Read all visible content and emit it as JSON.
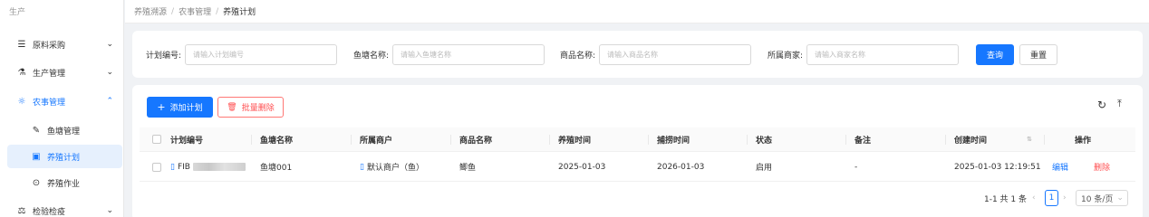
{
  "sidebar": {
    "top_label": "生产",
    "items": [
      {
        "label": "原料采购",
        "icon": "list-icon",
        "chevron": "⌄"
      },
      {
        "label": "生产管理",
        "icon": "flask-icon",
        "chevron": "⌄"
      },
      {
        "label": "农事管理",
        "icon": "sun-icon",
        "chevron": "⌃"
      },
      {
        "label": "鱼塘管理",
        "icon": "edit-icon"
      },
      {
        "label": "养殖计划",
        "icon": "calendar-icon"
      },
      {
        "label": "养殖作业",
        "icon": "play-icon"
      },
      {
        "label": "检验检疫",
        "icon": "scale-icon",
        "chevron": "⌄"
      }
    ]
  },
  "breadcrumb": [
    "养殖溯源",
    "农事管理",
    "养殖计划"
  ],
  "search": {
    "plan_no": {
      "label": "计划编号:",
      "placeholder": "请输入计划编号"
    },
    "pond_name": {
      "label": "鱼塘名称:",
      "placeholder": "请输入鱼塘名称"
    },
    "product_name": {
      "label": "商品名称:",
      "placeholder": "请输入商品名称"
    },
    "merchant": {
      "label": "所属商家:",
      "placeholder": "请输入商家名称"
    },
    "query_label": "查询",
    "reset_label": "重置"
  },
  "toolbar": {
    "add_label": "添加计划",
    "batch_delete_label": "批量删除"
  },
  "table": {
    "columns": [
      "计划编号",
      "鱼塘名称",
      "所属商户",
      "商品名称",
      "养殖时间",
      "捕捞时间",
      "状态",
      "备注",
      "创建时间",
      "操作"
    ],
    "rows": [
      {
        "plan_no_prefix": "FIB",
        "pond": "鱼塘001",
        "merchant": "默认商户（鱼）",
        "product": "鲫鱼",
        "farm_time": "2025-01-03",
        "catch_time": "2026-01-03",
        "status": "启用",
        "remark": "-",
        "created": "2025-01-03 12:19:51",
        "edit": "编辑",
        "delete": "删除"
      }
    ]
  },
  "pagination": {
    "summary": "1-1 共 1 条",
    "current_page": "1",
    "page_size": "10 条/页"
  },
  "colors": {
    "primary": "#1677ff",
    "danger": "#ff4d4f"
  }
}
